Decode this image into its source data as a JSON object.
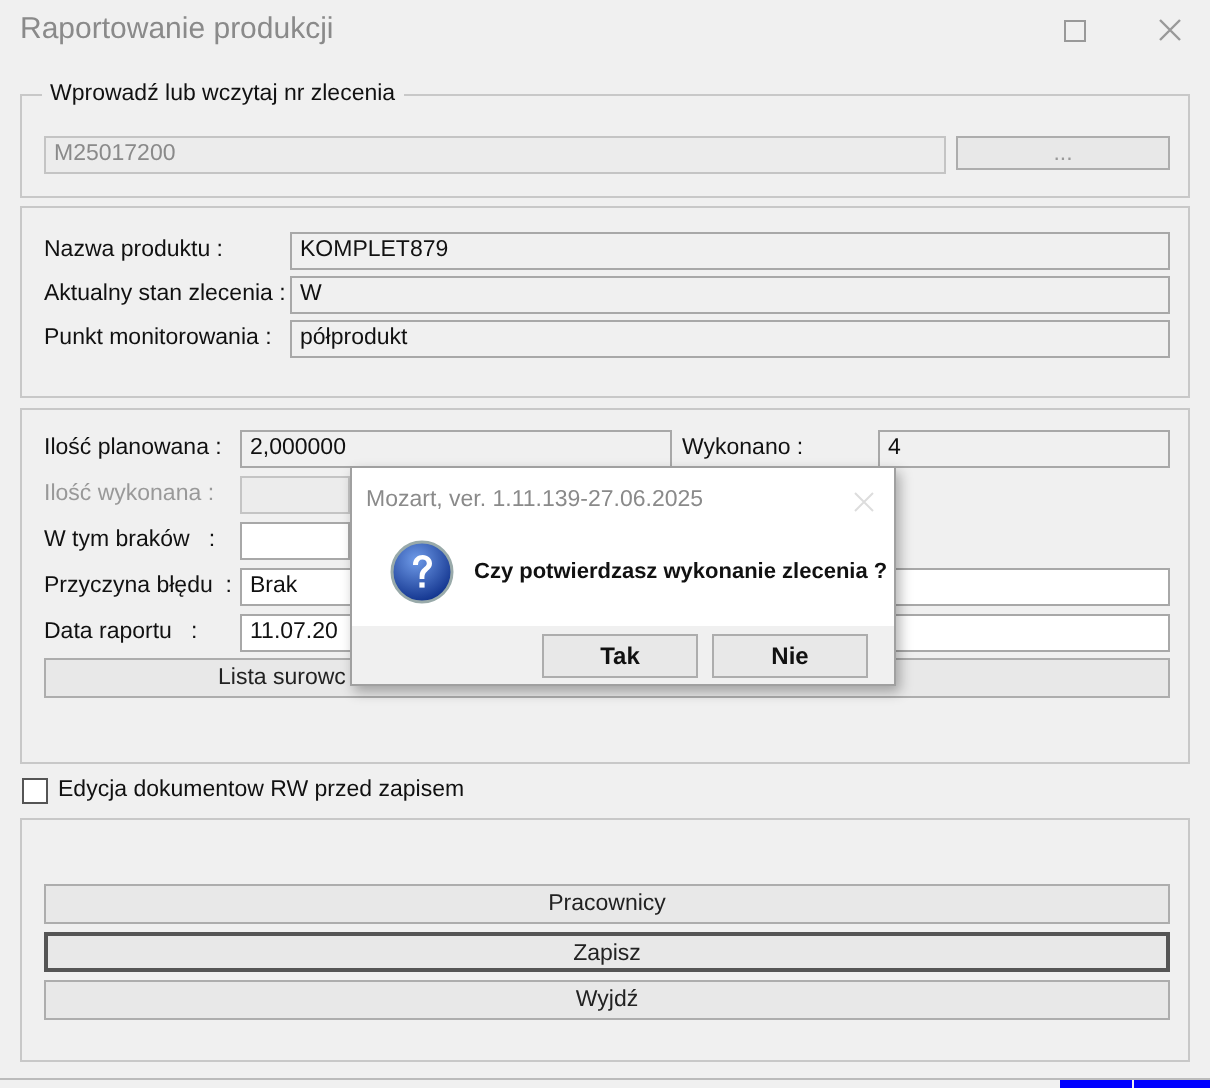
{
  "window": {
    "title": "Raportowanie produkcji"
  },
  "order_group": {
    "legend": "Wprowadź lub wczytaj nr zlecenia",
    "order_number": "M25017200",
    "browse_button": "..."
  },
  "product_fields": [
    {
      "label": "Nazwa produktu :",
      "value": "KOMPLET879"
    },
    {
      "label": "Aktualny stan zlecenia :",
      "value": "W"
    },
    {
      "label": "Punkt monitorowania :",
      "value": "półprodukt"
    }
  ],
  "quantity_rows": [
    {
      "label": "Ilość planowana :",
      "value": "2,000000",
      "editable": false,
      "disabled": false
    },
    {
      "label": "Ilość wykonana :",
      "value": "",
      "editable": false,
      "disabled": true
    },
    {
      "label": "W tym braków   :",
      "value": "",
      "editable": true,
      "disabled": false
    },
    {
      "label": "Przyczyna błędu  :",
      "value": "Brak",
      "editable": true,
      "disabled": false
    },
    {
      "label": "Data raportu   :",
      "value": "11.07.20",
      "editable": true,
      "disabled": false
    }
  ],
  "done": {
    "label": "Wykonano :",
    "value": "4"
  },
  "materials_button": "Lista surowc",
  "rw_edit_checkbox": {
    "label": "Edycja dokumentow RW przed zapisem",
    "checked": false
  },
  "actions": [
    {
      "label": "Pracownicy",
      "focused": false
    },
    {
      "label": "Zapisz",
      "focused": true
    },
    {
      "label": "Wyjdź",
      "focused": false
    }
  ],
  "dialog": {
    "title": "Mozart, ver. 1.11.139-27.06.2025",
    "message": "Czy potwierdzasz wykonanie zlecenia ?",
    "buttons": [
      {
        "label": "Tak",
        "selected": false
      },
      {
        "label": "Nie",
        "selected": false
      }
    ]
  }
}
